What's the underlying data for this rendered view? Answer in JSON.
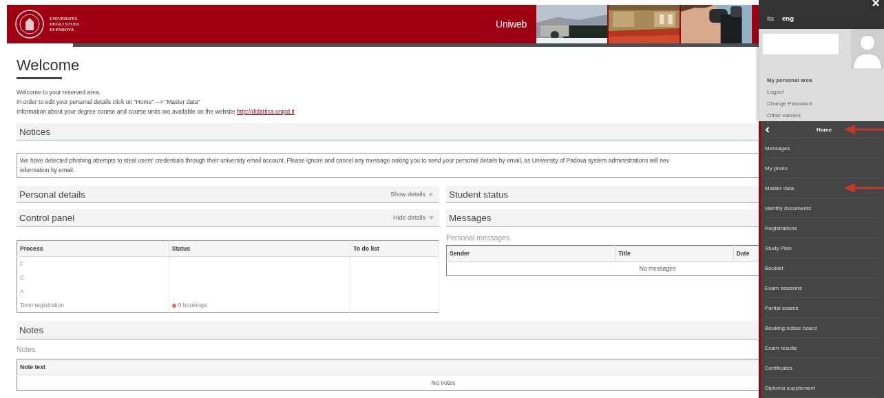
{
  "header": {
    "university": [
      "UNIVERSITÀ",
      "DEGLI STUDI",
      "DI PADOVA"
    ],
    "app_name": "Uniweb",
    "photos": [
      {
        "kind": "picture"
      },
      {
        "kind": "picture"
      },
      {
        "kind": "picture"
      }
    ]
  },
  "welcome": {
    "title": "Welcome",
    "lines": [
      "Welcome to your reserved area.",
      "In order to edit your personal details click on \"Home\" --> \"Master data\""
    ],
    "info_text": "Information about your degree course and course units are available on the website ",
    "info_link": "http://didattica.unipd.it"
  },
  "notices": {
    "title": "Notices",
    "lines": [
      "We have detected phishing attempts to steal users' credentials through their university email account. Please ignore and cancel any message asking you to send your personal details by email, as University of Padova system administrations will nev",
      "information by email."
    ]
  },
  "personal_details": {
    "title": "Personal details",
    "toggle": "Show details",
    "expanded": false
  },
  "control_panel": {
    "title": "Control panel",
    "toggle": "Hide details",
    "expanded": true,
    "table": {
      "columns": [
        "Process",
        "Status",
        "To do list"
      ],
      "rows": [
        {
          "process": "F",
          "status": "",
          "todo": ""
        },
        {
          "process": "C",
          "status": "",
          "todo": ""
        },
        {
          "process": "A",
          "status": "",
          "todo": ""
        },
        {
          "process": "Term registration",
          "status": "0 bookings",
          "todo": ""
        }
      ]
    }
  },
  "student_status": {
    "title": "Student status"
  },
  "messages": {
    "title": "Messages",
    "subtitle": "Personal messages",
    "columns": [
      "Sender",
      "Title",
      "Date"
    ],
    "empty": "No messages"
  },
  "notes": {
    "title": "Notes",
    "subtitle": "Notes",
    "columns": [
      "Note text"
    ],
    "empty": "No notes"
  },
  "sidebar": {
    "close": "×",
    "languages": [
      {
        "label": "ita",
        "selected": false
      },
      {
        "label": "eng",
        "selected": true
      }
    ],
    "user_links": [
      {
        "label": "My personal area",
        "kind": "heading"
      },
      {
        "label": "Logout",
        "kind": "link"
      },
      {
        "label": "Change Password",
        "kind": "link"
      },
      {
        "label": "Other careers",
        "kind": "link"
      }
    ],
    "menu_title": "Home",
    "menu": [
      {
        "label": "Messages",
        "arrow": false
      },
      {
        "label": "My photo",
        "arrow": false
      },
      {
        "label": "Master data",
        "arrow": true
      },
      {
        "label": "Identity documents",
        "arrow": false
      },
      {
        "label": "Registrations",
        "arrow": false
      },
      {
        "label": "Study Plan",
        "arrow": false
      },
      {
        "label": "Booklet",
        "arrow": false
      },
      {
        "label": "Exam sessions",
        "arrow": false
      },
      {
        "label": "Partial exams",
        "arrow": false
      },
      {
        "label": "Booking notice board",
        "arrow": false
      },
      {
        "label": "Exam results",
        "arrow": false
      },
      {
        "label": "Certificates",
        "arrow": false
      },
      {
        "label": "Diploma supplement",
        "arrow": false
      }
    ],
    "menu_title_arrow": true
  }
}
